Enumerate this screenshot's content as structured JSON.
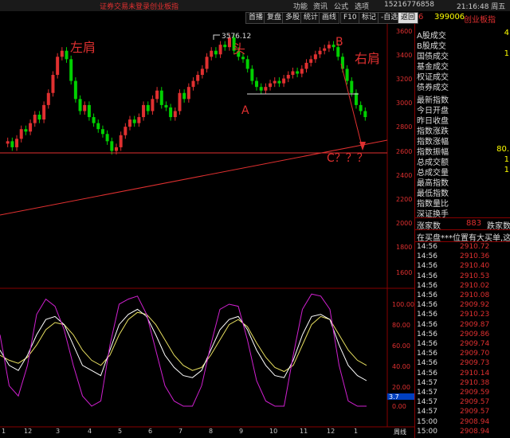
{
  "topbar": {
    "login_status": "证券交易未登录",
    "board_link": "创业板指",
    "menu": [
      "功能",
      "资讯",
      "公式",
      "选项"
    ],
    "phone": "15216776858",
    "clock": "21:16:48 周五"
  },
  "toolbar": {
    "buttons": [
      "首播",
      "复盘",
      "多股",
      "统计",
      "画线",
      "F10",
      "标记",
      "-自选",
      "返回"
    ],
    "index_num": "6",
    "index_code": "399006",
    "index_name": "创业板指"
  },
  "chart_labels": {
    "left_shoulder": "左肩",
    "head": "头",
    "right_shoulder": "右肩",
    "point_a": "A",
    "point_b": "B",
    "point_c": "C？？？",
    "peak_value": "3576.12"
  },
  "price_axis": [
    "3600",
    "3400",
    "3200",
    "3000",
    "2800",
    "2600",
    "2400",
    "2200",
    "2000",
    "1800",
    "1600"
  ],
  "osc_axis": [
    "100.00",
    "80.00",
    "60.00",
    "40.00",
    "20.00",
    "0.00"
  ],
  "osc_marker": "3.7",
  "date_axis": [
    "1",
    "12",
    "3",
    "4",
    "5",
    "6",
    "7",
    "8",
    "9",
    "10",
    "11",
    "12",
    "1"
  ],
  "date_tab": "周线",
  "panel": {
    "market_rows": [
      {
        "label": "A股成交",
        "value": "4"
      },
      {
        "label": "B股成交",
        "value": ""
      },
      {
        "label": "国债成交",
        "value": "1"
      },
      {
        "label": "基金成交",
        "value": ""
      },
      {
        "label": "权证成交",
        "value": ""
      },
      {
        "label": "债券成交",
        "value": ""
      }
    ],
    "index_rows": [
      {
        "label": "最新指数",
        "value": ""
      },
      {
        "label": "今日开盘",
        "value": ""
      },
      {
        "label": "昨日收盘",
        "value": ""
      },
      {
        "label": "指数涨跌",
        "value": ""
      },
      {
        "label": "指数涨幅",
        "value": ""
      },
      {
        "label": "指数振幅",
        "value": "80."
      },
      {
        "label": "总成交额",
        "value": "1"
      },
      {
        "label": "总成交量",
        "value": "1"
      },
      {
        "label": "最高指数",
        "value": ""
      },
      {
        "label": "最低指数",
        "value": ""
      },
      {
        "label": "指数量比",
        "value": ""
      },
      {
        "label": "深证换手",
        "value": ""
      }
    ],
    "updown": {
      "up_label": "涨家数",
      "up_count": "883",
      "down_label": "跌家数"
    },
    "notice": "在买盘***位置有大买单,这",
    "ticks": [
      {
        "time": "14:56",
        "price": "2910.72"
      },
      {
        "time": "14:56",
        "price": "2910.36"
      },
      {
        "time": "14:56",
        "price": "2910.40"
      },
      {
        "time": "14:56",
        "price": "2910.53"
      },
      {
        "time": "14:56",
        "price": "2910.02"
      },
      {
        "time": "14:56",
        "price": "2910.08"
      },
      {
        "time": "14:56",
        "price": "2909.92"
      },
      {
        "time": "14:56",
        "price": "2910.23"
      },
      {
        "time": "14:56",
        "price": "2909.87"
      },
      {
        "time": "14:56",
        "price": "2909.86"
      },
      {
        "time": "14:56",
        "price": "2909.74"
      },
      {
        "time": "14:56",
        "price": "2909.70"
      },
      {
        "time": "14:56",
        "price": "2909.73"
      },
      {
        "time": "14:56",
        "price": "2910.14"
      },
      {
        "time": "14:57",
        "price": "2910.38"
      },
      {
        "time": "14:57",
        "price": "2909.59"
      },
      {
        "time": "14:57",
        "price": "2909.57"
      },
      {
        "time": "14:57",
        "price": "2909.57"
      },
      {
        "time": "15:00",
        "price": "2908.94"
      },
      {
        "time": "15:00",
        "price": "2908.94"
      }
    ]
  },
  "colors": {
    "up": "#e03030",
    "down": "#00d000",
    "k": "#ffffff",
    "d": "#e8e060",
    "j": "#d020d0"
  }
}
